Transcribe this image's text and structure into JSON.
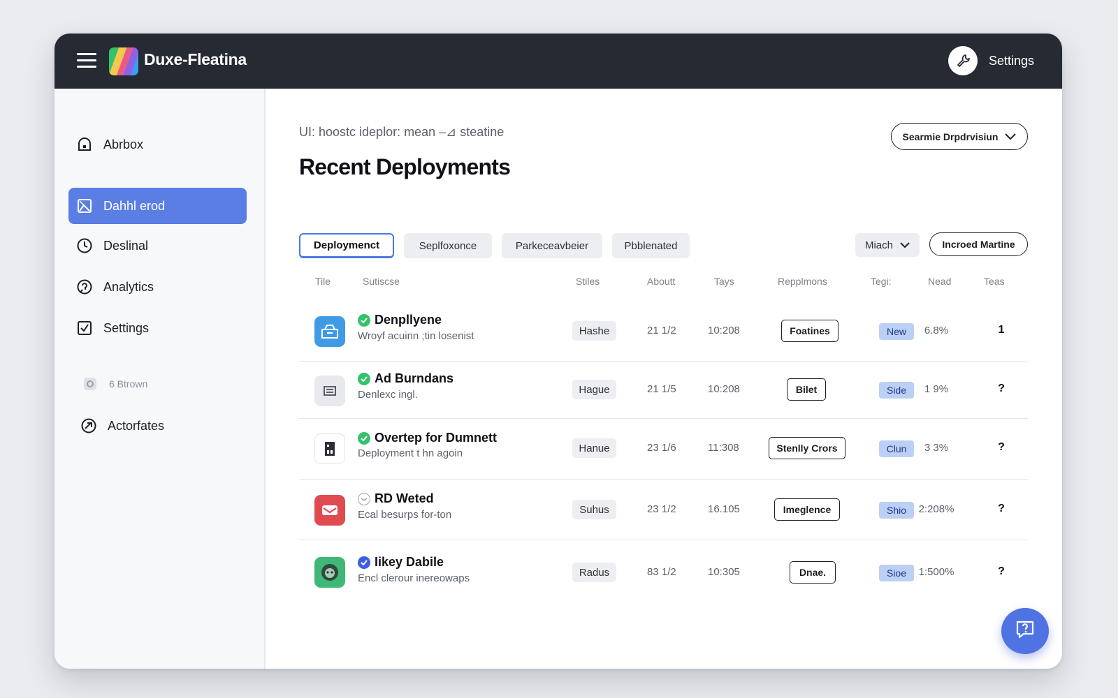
{
  "app": {
    "title": "Duxe-Fleatina"
  },
  "header": {
    "settings_label": "Settings"
  },
  "sidebar": {
    "items": [
      {
        "label": "Abrbox",
        "icon": "home-icon"
      },
      {
        "label": "Dahhl erod",
        "icon": "image-icon",
        "active": true
      },
      {
        "label": "Deslinal",
        "icon": "clock-icon"
      },
      {
        "label": "Analytics",
        "icon": "analytics-icon"
      },
      {
        "label": "Settings",
        "icon": "checkbox-icon"
      },
      {
        "label": "6 Btrown",
        "icon": "muted-box-icon"
      },
      {
        "label": "Actorfates",
        "icon": "compass-icon"
      }
    ]
  },
  "main": {
    "breadcrumb": "UI: hoostc ideplor: mean –⊿ steatine",
    "title": "Recent Deployments",
    "division_select": "Searmie Drpdrvisiun",
    "tabs": [
      "Deploymenct",
      "Seplfoxonce",
      "Parkeceavbeier",
      "Pbblenated"
    ],
    "match_select": "Miach",
    "action_button": "Incroed Martine",
    "columns": [
      "Tile",
      "Sutiscse",
      "Stiles",
      "Aboutt",
      "Tays",
      "Repplmons",
      "Tegi:",
      "Nead",
      "Teas"
    ],
    "rows": [
      {
        "title": "Denpllyene",
        "subtitle": "Wroyf acuinn ;tin losenist",
        "status": "green-check",
        "chip": "Hashe",
        "about": "21 1/2",
        "time": "10:208",
        "tag": "Foatines",
        "badge": "New",
        "pct": "6.8%",
        "teas": "1",
        "icon": "box-icon",
        "icon_bg": "#3f9be6"
      },
      {
        "title": "Ad Burndans",
        "subtitle": "Denlexc ingl.",
        "status": "green-check",
        "chip": "Hague",
        "about": "21 1/5",
        "time": "10:208",
        "tag": "Bilet",
        "badge": "Side",
        "pct": "1 9%",
        "teas": "?",
        "icon": "tray-icon",
        "icon_bg": "#e7e9ee"
      },
      {
        "title": "Overtep for  Dumnett",
        "subtitle": "Deployment t hn agoin",
        "status": "green-check",
        "chip": "Hanue",
        "about": "23 1/6",
        "time": "11:308",
        "tag": "Stenlly Crors",
        "badge": "Clun",
        "pct": "3 3%",
        "teas": "?",
        "icon": "door-icon",
        "icon_bg": "#ffffff"
      },
      {
        "title": "RD Weted",
        "subtitle": "Ecal besurps for-ton",
        "status": "outline-check",
        "chip": "Suhus",
        "about": "23 1/2",
        "time": "16.105",
        "tag": "Imeglence",
        "badge": "Shio",
        "pct": "2:208%",
        "teas": "?",
        "icon": "mail-icon",
        "icon_bg": "#e04b52"
      },
      {
        "title": "Iikey Dabile",
        "subtitle": "Encl clerour inereowaps",
        "status": "blue-check",
        "chip": "Radus",
        "about": "83 1/2",
        "time": "10:305",
        "tag": "Dnae.",
        "badge": "Sioe",
        "pct": "1:500%",
        "teas": "?",
        "icon": "character-icon",
        "icon_bg": "#3fb877"
      }
    ]
  },
  "help_button": {
    "icon": "help-chat-icon"
  },
  "colors": {
    "accent": "#5b7ee5",
    "topbar": "#262a33",
    "badge_bg": "#bcd0f5",
    "success": "#34c26b"
  }
}
